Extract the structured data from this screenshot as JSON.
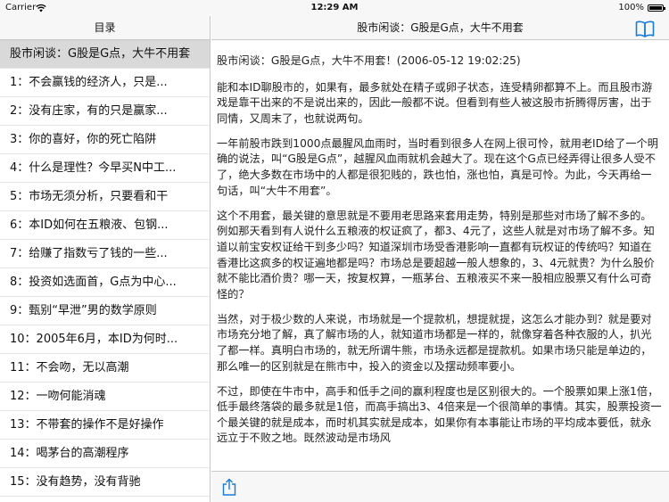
{
  "status": {
    "carrier": "Carrier",
    "time": "12:29 AM",
    "battery": "100%",
    "icons": [
      "wifi-icon",
      "battery-icon"
    ]
  },
  "master": {
    "title": "目录",
    "items": [
      "股市闲谈：G股是G点，大牛不用套",
      "1：不会赢钱的经济人，只是...",
      "2：没有庄家，有的只是赢家...",
      "3：你的喜好，你的死亡陷阱",
      "4：什么是理性？今早买N中工...",
      "5：市场无须分析，只要看和干",
      "6：本ID如何在五粮液、包钢...",
      "7：给赚了指数亏了钱的一些...",
      "8：投资如选面首，G点为中心...",
      "9：甄别“早泄”男的数学原则",
      "10：2005年6月，本ID为何时...",
      "11：不会吻，无以高潮",
      "12：一吻何能消魂",
      "13：不带套的操作不是好操作",
      "14：喝茅台的高潮程序",
      "15：没有趋势，没有背驰"
    ]
  },
  "detail": {
    "title": "股市闲谈：G股是G点，大牛不用套",
    "icons": [
      "book-icon",
      "share-icon"
    ],
    "paragraphs": [
      "股市闲谈：G股是G点，大牛不用套！(2006-05-12 19:02:25)",
      "能和本ID聊股市的，如果有，最多就处在精子或卵子状态，连受精卵都算不上。而且股市游戏是靠干出来的不是说出来的，因此一般都不说。但看到有些人被这股市折腾得厉害，出于同情，又周末了，也就说两句。",
      "一年前股市跌到1000点最腥风血雨时，当时看到很多人在网上很可怜，就用老ID给了一个明确的说法，叫“G股是G点”，越腥风血雨就机会越大了。现在这个G点已经弄得让很多人受不了，绝大多数在市场中的人都是很犯贱的，跌也怕，涨也怕，真是可怜。为此，今天再给一句话，叫“大牛不用套”。",
      "这个不用套，最关键的意思就是不要用老思路来套用走势，特别是那些对市场了解不多的。例如那天看到有人说什么五粮液的权证疯了，都3、4元了，这些人就是对市场了解不多。知道以前宝安权证给干到多少吗？知道深圳市场受香港影响一直都有玩权证的传统吗？知道在香港比这疯多的权证遍地都是吗？市场总是要超越一般人想象的，3、4元就贵？为什么股价就不能比酒价贵？哪一天，按复权算，一瓶茅台、五粮液买不来一股相应股票又有什么可奇怪的？",
      "当然，对于极少数的人来说，市场就是一个提款机，想提就提，这怎么才能办到？就是要对市场充分地了解，真了解市场的人，就知道市场都是一样的，就像穿着各种衣服的人，扒光了都一样。真明白市场的，就无所谓牛熊，市场永远都是提款机。如果市场只能是单边的，那么唯一的区别就是在熊市中，投入的资金以及摆动频率要小。",
      "不过，即使在牛市中，高手和低手之间的赢利程度也是区别很大的。一个股票如果上涨1倍，低手最终落袋的最多就是1倍，而高手搞出3、4倍来是一个很简单的事情。其实，股票投资一个最关键的就是成本，而时机其实就是成本，如果你有本事能让市场的平均成本要低，就永远立于不败之地。既然波动是市场风"
    ]
  }
}
